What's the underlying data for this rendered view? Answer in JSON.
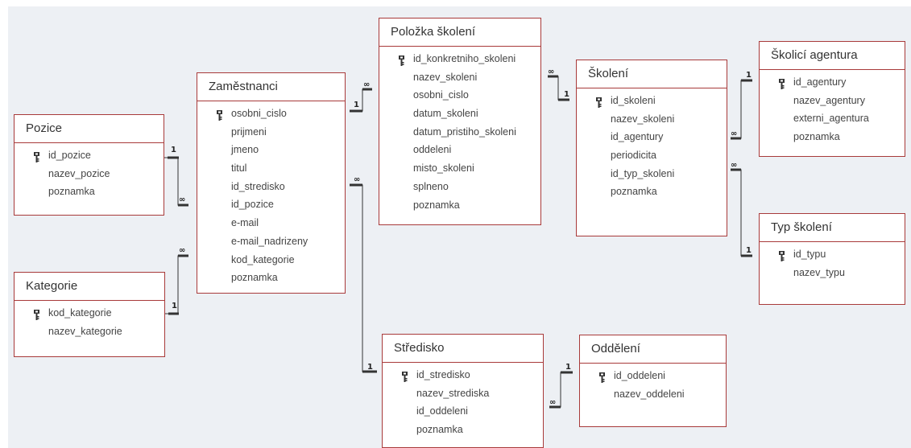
{
  "tables": {
    "pozice": {
      "title": "Pozice",
      "fields": [
        {
          "name": "id_pozice",
          "pk": true
        },
        {
          "name": "nazev_pozice",
          "pk": false
        },
        {
          "name": "poznamka",
          "pk": false
        }
      ]
    },
    "kategorie": {
      "title": "Kategorie",
      "fields": [
        {
          "name": "kod_kategorie",
          "pk": true
        },
        {
          "name": "nazev_kategorie",
          "pk": false
        }
      ]
    },
    "zamestnanci": {
      "title": "Zaměstnanci",
      "fields": [
        {
          "name": "osobni_cislo",
          "pk": true
        },
        {
          "name": "prijmeni",
          "pk": false
        },
        {
          "name": "jmeno",
          "pk": false
        },
        {
          "name": "titul",
          "pk": false
        },
        {
          "name": "id_stredisko",
          "pk": false
        },
        {
          "name": "id_pozice",
          "pk": false
        },
        {
          "name": "e-mail",
          "pk": false
        },
        {
          "name": "e-mail_nadrizeny",
          "pk": false
        },
        {
          "name": "kod_kategorie",
          "pk": false
        },
        {
          "name": "poznamka",
          "pk": false
        }
      ]
    },
    "polozka_skoleni": {
      "title": "Položka školení",
      "fields": [
        {
          "name": "id_konkretniho_skoleni",
          "pk": true
        },
        {
          "name": "nazev_skoleni",
          "pk": false
        },
        {
          "name": "osobni_cislo",
          "pk": false
        },
        {
          "name": "datum_skoleni",
          "pk": false
        },
        {
          "name": "datum_pristiho_skoleni",
          "pk": false
        },
        {
          "name": "oddeleni",
          "pk": false
        },
        {
          "name": "misto_skoleni",
          "pk": false
        },
        {
          "name": "splneno",
          "pk": false
        },
        {
          "name": "poznamka",
          "pk": false
        }
      ]
    },
    "skoleni": {
      "title": "Školení",
      "fields": [
        {
          "name": "id_skoleni",
          "pk": true
        },
        {
          "name": "nazev_skoleni",
          "pk": false
        },
        {
          "name": "id_agentury",
          "pk": false
        },
        {
          "name": "periodicita",
          "pk": false
        },
        {
          "name": "id_typ_skoleni",
          "pk": false
        },
        {
          "name": "poznamka",
          "pk": false
        }
      ]
    },
    "skolici_agentura": {
      "title": "Školicí agentura",
      "fields": [
        {
          "name": "id_agentury",
          "pk": true
        },
        {
          "name": "nazev_agentury",
          "pk": false
        },
        {
          "name": "externi_agentura",
          "pk": false
        },
        {
          "name": "poznamka",
          "pk": false
        }
      ]
    },
    "typ_skoleni": {
      "title": "Typ školení",
      "fields": [
        {
          "name": "id_typu",
          "pk": true
        },
        {
          "name": "nazev_typu",
          "pk": false
        }
      ]
    },
    "stredisko": {
      "title": "Středisko",
      "fields": [
        {
          "name": "id_stredisko",
          "pk": true
        },
        {
          "name": "nazev_strediska",
          "pk": false
        },
        {
          "name": "id_oddeleni",
          "pk": false
        },
        {
          "name": "poznamka",
          "pk": false
        }
      ]
    },
    "oddeleni": {
      "title": "Oddělení",
      "fields": [
        {
          "name": "id_oddeleni",
          "pk": true
        },
        {
          "name": "nazev_oddeleni",
          "pk": false
        }
      ]
    }
  },
  "cardinality": {
    "one": "1",
    "many": "∞"
  },
  "colors": {
    "table_border": "#a83a3a",
    "canvas": "#edf0f4",
    "line": "#333333"
  },
  "icons": {
    "primary_key": "key-icon"
  }
}
